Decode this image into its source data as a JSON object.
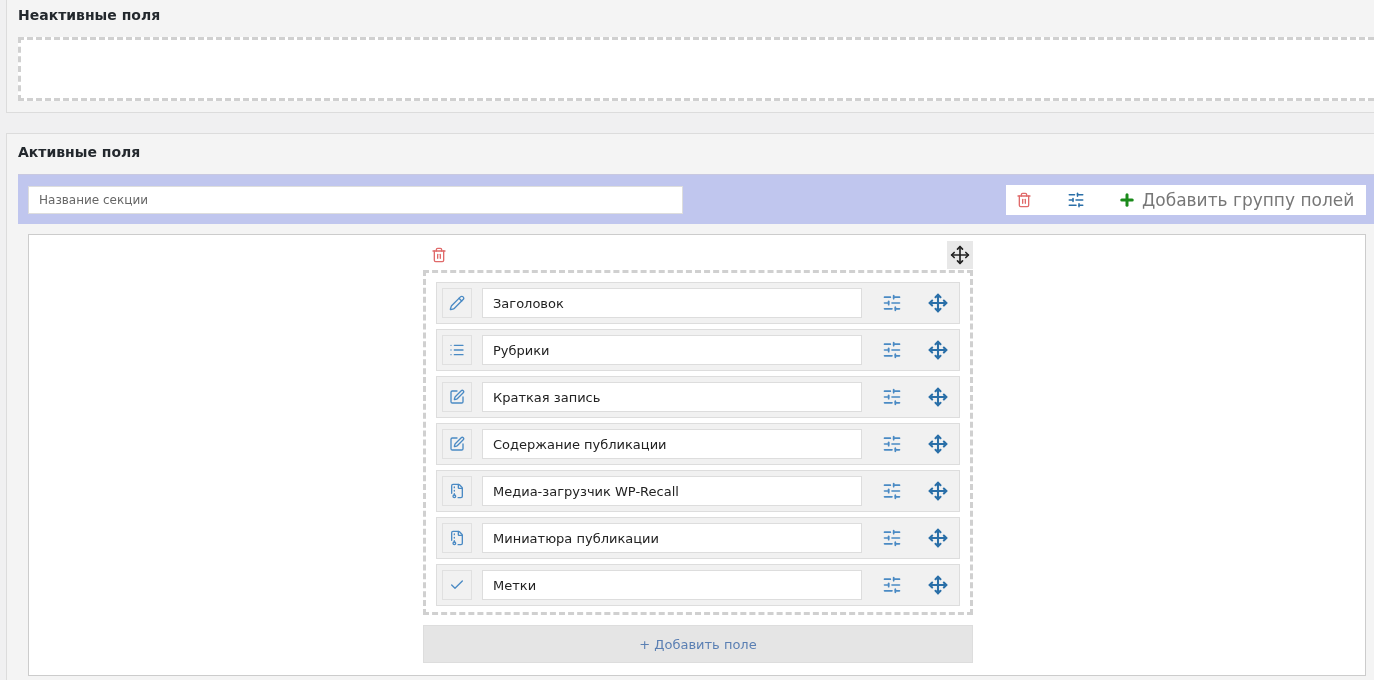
{
  "inactive_panel": {
    "title": "Неактивные поля"
  },
  "active_panel": {
    "title": "Активные поля",
    "section": {
      "name_placeholder": "Название секции",
      "add_group_label": "Добавить группу полей",
      "group": {
        "fields": [
          {
            "kind": "pencil",
            "name": "Заголовок"
          },
          {
            "kind": "list",
            "name": "Рубрики"
          },
          {
            "kind": "edit",
            "name": "Краткая запись"
          },
          {
            "kind": "edit",
            "name": "Содержание публикации"
          },
          {
            "kind": "file",
            "name": "Медиа-загрузчик WP-Recall"
          },
          {
            "kind": "file",
            "name": "Миниатюра публикации"
          },
          {
            "kind": "check",
            "name": "Метки"
          }
        ],
        "add_field_label": "+ Добавить поле"
      }
    }
  }
}
